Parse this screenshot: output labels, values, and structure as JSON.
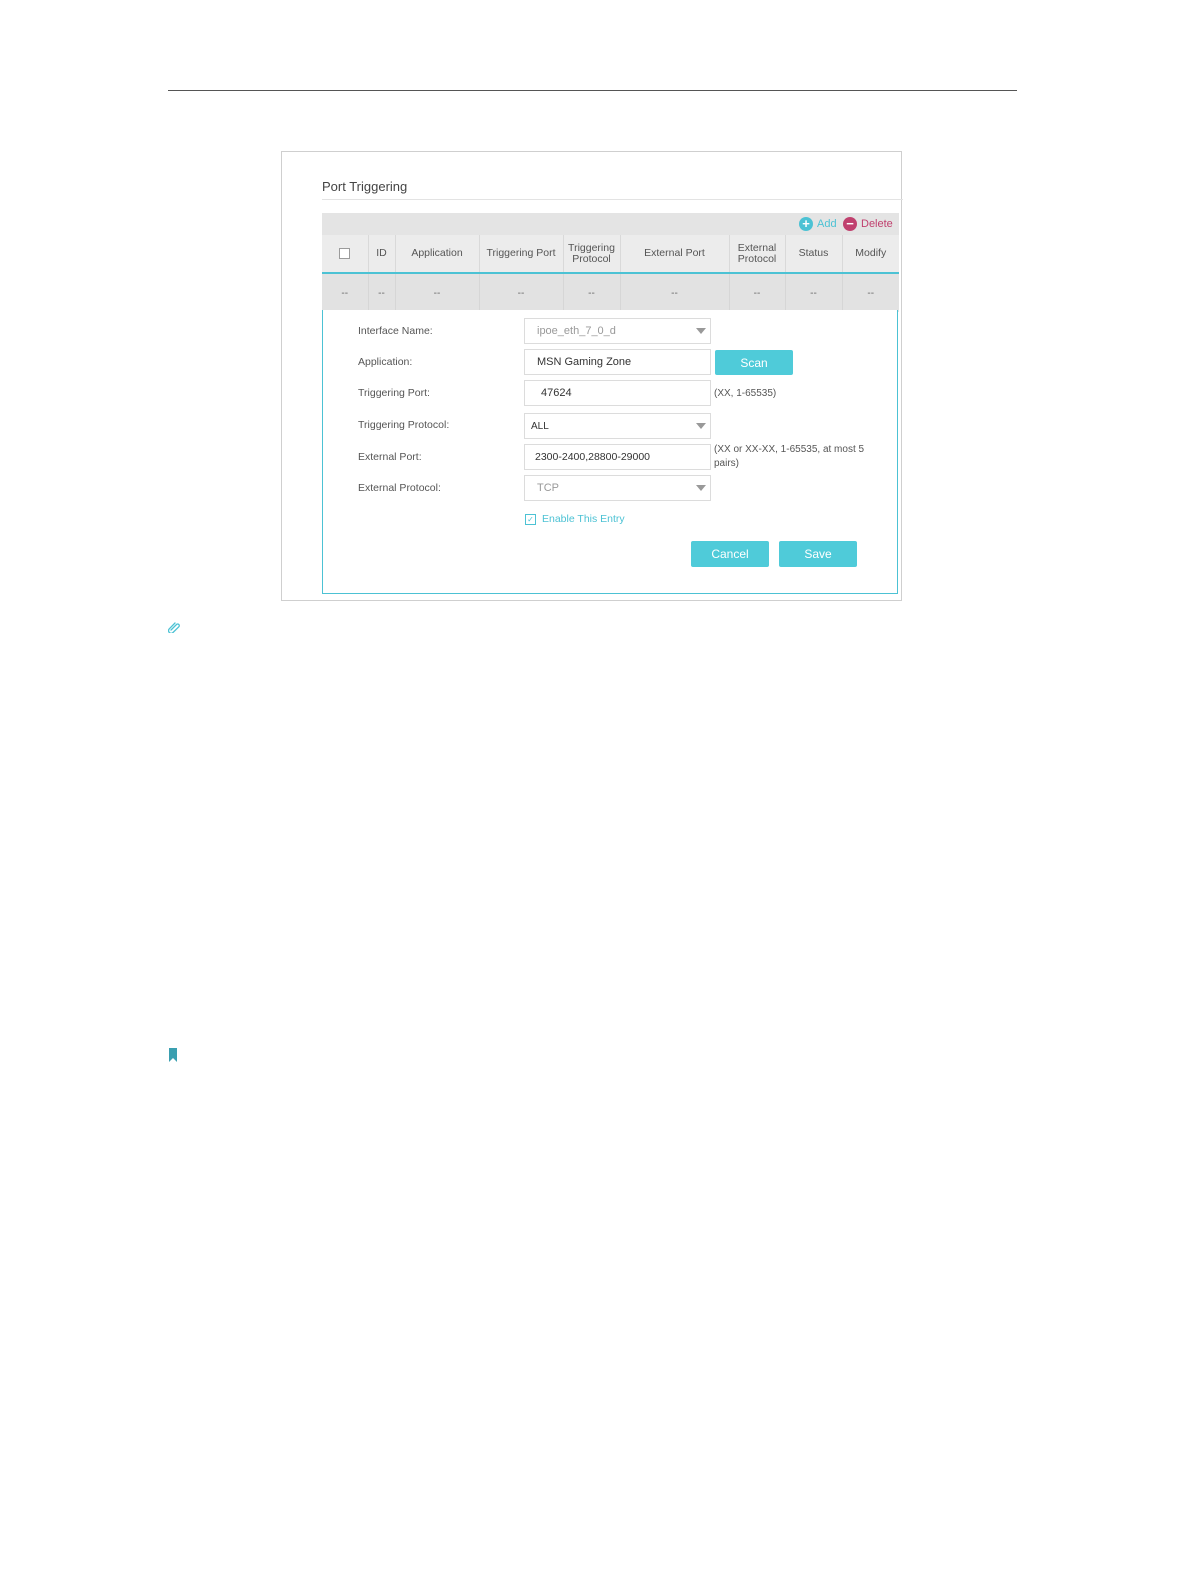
{
  "panel": {
    "title": "Port Triggering",
    "toolbar": {
      "add_label": "Add",
      "delete_label": "Delete"
    },
    "columns": [
      "",
      "ID",
      "Application",
      "Triggering Port",
      "Triggering Protocol",
      "External Port",
      "External Protocol",
      "Status",
      "Modify"
    ],
    "row": [
      "--",
      "--",
      "--",
      "--",
      "--",
      "--",
      "--",
      "--",
      "--"
    ]
  },
  "form": {
    "interface_name": {
      "label": "Interface Name:",
      "value": "ipoe_eth_7_0_d"
    },
    "application": {
      "label": "Application:",
      "value": "MSN Gaming  Zone",
      "scan_label": "Scan"
    },
    "triggering_port": {
      "label": "Triggering Port:",
      "value": "47624",
      "hint": "(XX, 1-65535)"
    },
    "triggering_protocol": {
      "label": "Triggering Protocol:",
      "value": "ALL"
    },
    "external_port": {
      "label": "External Port:",
      "value": "2300-2400,28800-29000",
      "hint": "(XX or XX-XX, 1-65535, at most 5 pairs)"
    },
    "external_protocol": {
      "label": "External Protocol:",
      "value": "TCP"
    },
    "enable_entry": {
      "label": "Enable This Entry",
      "checked": true
    },
    "cancel_label": "Cancel",
    "save_label": "Save"
  },
  "icons": {
    "note": "note-clip-icon",
    "bookmark": "bookmark-icon"
  },
  "colors": {
    "accent": "#4fcbd9",
    "delete": "#c0406e"
  }
}
